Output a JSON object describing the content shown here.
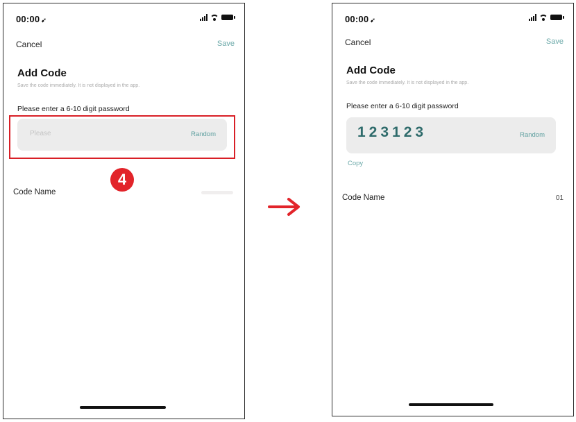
{
  "left": {
    "status": {
      "time": "00:00",
      "location_glyph": "➹"
    },
    "nav": {
      "cancel": "Cancel",
      "save": "Save"
    },
    "title": "Add Code",
    "subtitle": "Save the code immediately. It is not displayed in the app.",
    "prompt": "Please enter a 6-10 digit password",
    "password_placeholder": "Please",
    "random_label": "Random",
    "step_number": "4",
    "code_name_label": "Code Name"
  },
  "right": {
    "status": {
      "time": "00:00",
      "location_glyph": "➹"
    },
    "nav": {
      "cancel": "Cancel",
      "save": "Save"
    },
    "title": "Add Code",
    "subtitle": "Save the code immediately. It is not displayed in the app.",
    "prompt": "Please enter a 6-10 digit password",
    "password_value": "123123",
    "random_label": "Random",
    "copy_label": "Copy",
    "code_name_label": "Code Name",
    "code_name_value": "01"
  },
  "colors": {
    "accent": "#6aa8a8",
    "password_text": "#2e6b6b",
    "highlight": "#d81f26",
    "field_bg": "#ececec"
  },
  "icons": [
    "location-arrow-icon",
    "signal-bars-icon",
    "wifi-icon",
    "battery-icon",
    "right-arrow-icon"
  ]
}
